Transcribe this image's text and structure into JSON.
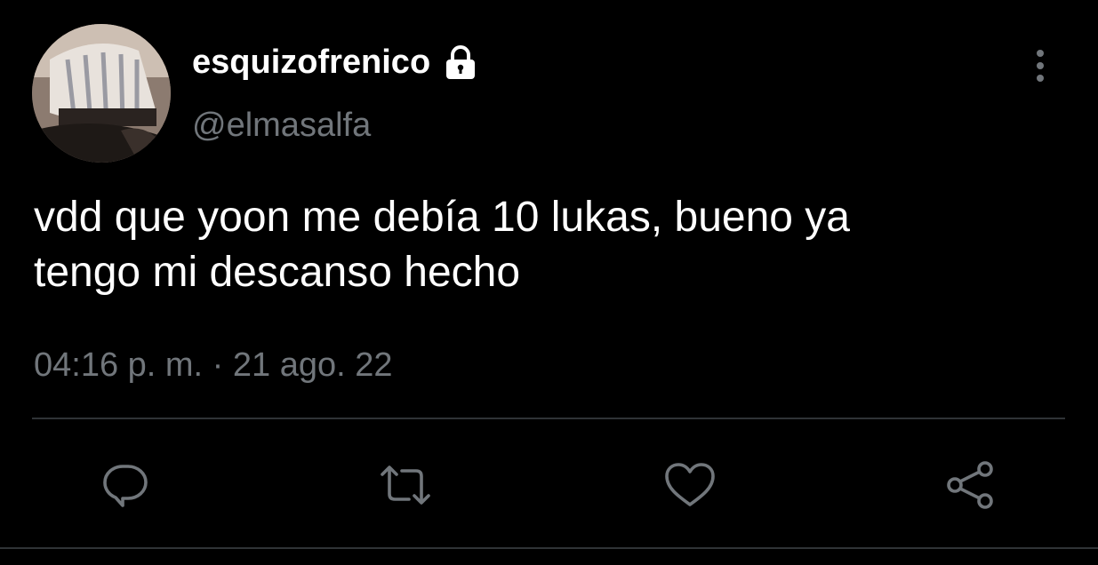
{
  "user": {
    "display_name": "esquizofrenico",
    "handle": "@elmasalfa",
    "protected": true
  },
  "tweet": {
    "text_line_1": "vdd que yoon me debía 10 lukas, bueno ya",
    "text_line_2": "tengo mi descanso hecho",
    "timestamp": "04:16 p. m. · 21 ago. 22"
  },
  "icons": {
    "lock": "lock-icon",
    "more": "vertical-ellipsis-icon",
    "reply": "speech-bubble-icon",
    "retweet": "retweet-icon",
    "like": "heart-icon",
    "share": "share-icon"
  },
  "colors": {
    "background": "#000000",
    "primary_text": "#ffffff",
    "secondary_text": "#71767b",
    "divider": "#2f3336"
  }
}
